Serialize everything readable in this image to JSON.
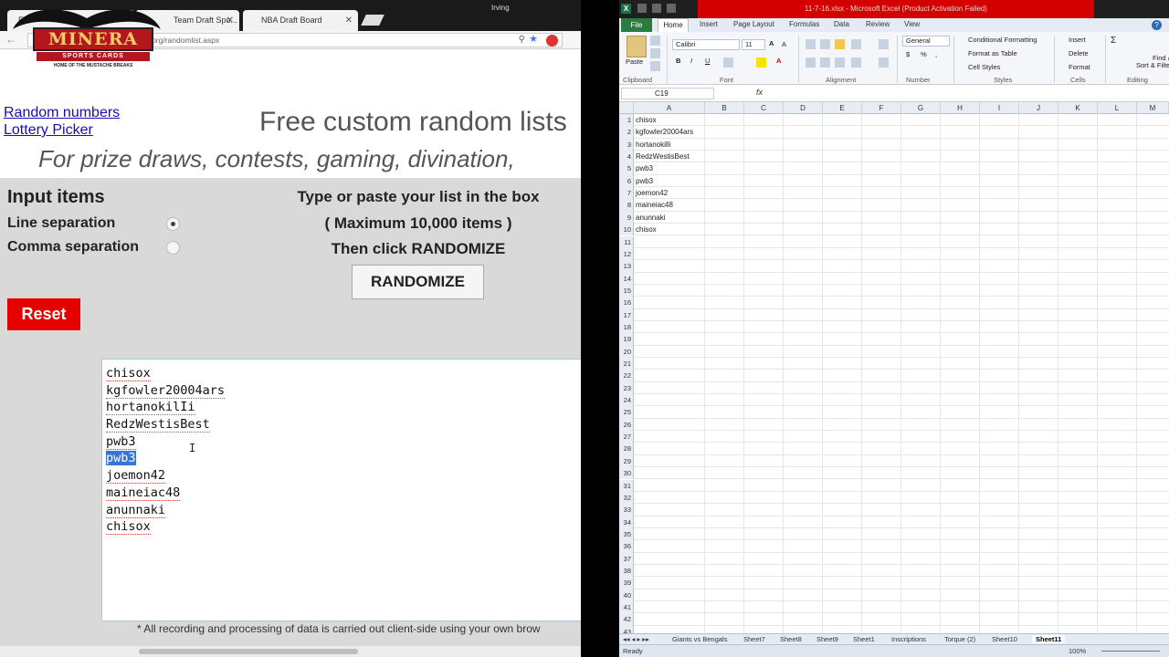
{
  "browser": {
    "tabs": [
      {
        "label": "E..."
      },
      {
        "label": "Team Draft Spo..."
      },
      {
        "label": "NBA Draft Board"
      }
    ],
    "tab_close": "✕",
    "window_user": "Irving",
    "address": "...org/randomlist.aspx",
    "logo": {
      "name": "MINERA",
      "sub": "SPORTS CARDS",
      "tagline": "HOME OF THE MUSTACHE BREAKS"
    }
  },
  "page": {
    "nav_links": [
      "Random numbers",
      "Lottery Picker"
    ],
    "title": "Free custom random lists",
    "subtitle": "For prize draws, contests, gaming, divination,",
    "input_items_title": "Input items",
    "line_separation": "Line separation",
    "comma_separation": "Comma separation",
    "instructions": [
      "Type or paste your list in the box",
      "( Maximum 10,000 items )",
      "Then click RANDOMIZE"
    ],
    "randomize_label": "RANDOMIZE",
    "reset_label": "Reset",
    "list_items": [
      "chisox",
      "kgfowler20004ars",
      "hortanokilIi",
      "RedzWestisBest",
      "pwb3",
      "pwb3",
      "joemon42",
      "maineiac48",
      "anunnaki",
      "chisox"
    ],
    "selected_index": 5,
    "footnote": "* All recording and processing of data is carried out client-side using your own brow"
  },
  "excel": {
    "title": "11-7-16.xlsx - Microsoft Excel (Product Activation Failed)",
    "tabs": [
      "File",
      "Home",
      "Insert",
      "Page Layout",
      "Formulas",
      "Data",
      "Review",
      "View"
    ],
    "font_name": "Calibri",
    "font_size": "11",
    "number_format": "General",
    "groups": [
      "Clipboard",
      "Font",
      "Alignment",
      "Number",
      "Styles",
      "Cells",
      "Editing"
    ],
    "paste_label": "Paste",
    "styles": [
      "Conditional Formatting",
      "Format as Table",
      "Cell Styles"
    ],
    "cells_buttons": [
      "Insert",
      "Delete",
      "Format"
    ],
    "editing_buttons": [
      "Sort & Filter",
      "Find & Select"
    ],
    "name_box": "C19",
    "fx": "fx",
    "columns": [
      "A",
      "B",
      "C",
      "D",
      "E",
      "F",
      "G",
      "H",
      "I",
      "J",
      "K",
      "L",
      "M"
    ],
    "column_a_values": [
      "chisox",
      "kgfowler20004ars",
      "hortanokilli",
      "RedzWestisBest",
      "pwb3",
      "pwb3",
      "joemon42",
      "maineiac48",
      "anunnaki",
      "chisox"
    ],
    "row_count": 43,
    "sheet_tabs": [
      "Giants vs Bengals",
      "Sheet7",
      "Sheet8",
      "Sheet9",
      "Sheet1",
      "Inscriptions",
      "Torque (2)",
      "Sheet10",
      "Sheet11"
    ],
    "active_sheet": "Sheet11",
    "status": "Ready",
    "zoom": "100%"
  }
}
